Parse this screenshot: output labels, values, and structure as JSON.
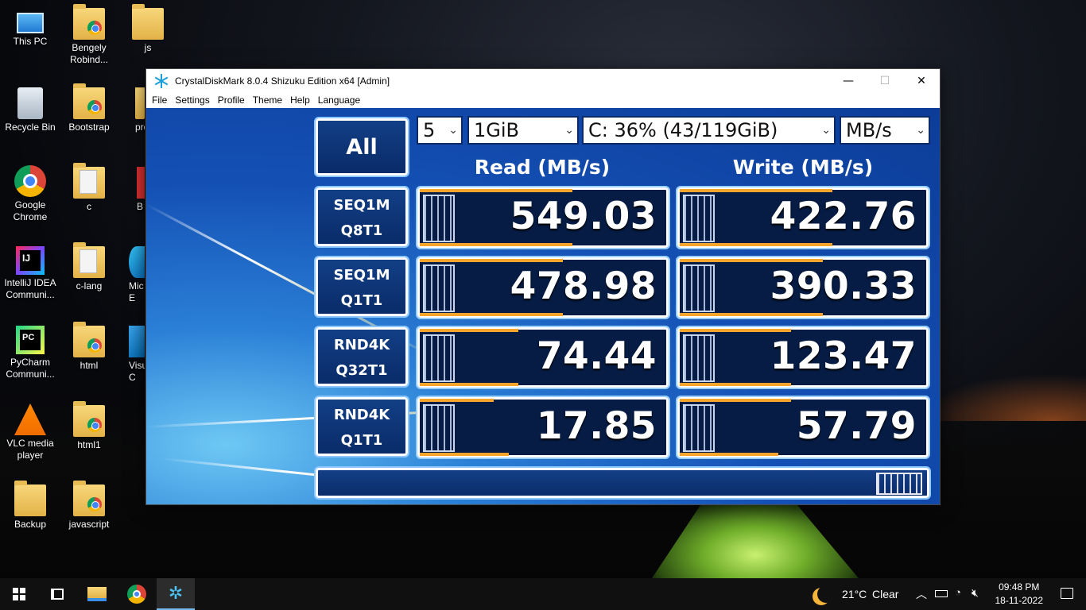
{
  "desktop": {
    "icons": [
      {
        "label": "This PC"
      },
      {
        "label": "Bengely Robind..."
      },
      {
        "label": "js"
      },
      {
        "label": "Recycle Bin"
      },
      {
        "label": "Bootstrap"
      },
      {
        "label": "pro"
      },
      {
        "label": "Google Chrome"
      },
      {
        "label": "c"
      },
      {
        "label": "B"
      },
      {
        "label": "IntelliJ IDEA Communi..."
      },
      {
        "label": "c-lang"
      },
      {
        "label": "Mic E"
      },
      {
        "label": "PyCharm Communi..."
      },
      {
        "label": "html"
      },
      {
        "label": "Visua C"
      },
      {
        "label": "VLC media player"
      },
      {
        "label": "html1"
      },
      {
        "label": "Backup"
      },
      {
        "label": "javascript"
      }
    ]
  },
  "window": {
    "title": "CrystalDiskMark 8.0.4 Shizuku Edition x64 [Admin]",
    "controls": {
      "minimize": "—",
      "maximize": "☐",
      "close": "✕"
    },
    "menu": [
      "File",
      "Settings",
      "Profile",
      "Theme",
      "Help",
      "Language"
    ]
  },
  "cdm": {
    "all_label": "All",
    "count": "5",
    "size": "1GiB",
    "drive": "C: 36% (43/119GiB)",
    "unit": "MB/s",
    "read_header": "Read (MB/s)",
    "write_header": "Write (MB/s)",
    "tests": [
      {
        "line1": "SEQ1M",
        "line2": "Q8T1",
        "read": "549.03",
        "write": "422.76"
      },
      {
        "line1": "SEQ1M",
        "line2": "Q1T1",
        "read": "478.98",
        "write": "390.33"
      },
      {
        "line1": "RND4K",
        "line2": "Q32T1",
        "read": "74.44",
        "write": "123.47"
      },
      {
        "line1": "RND4K",
        "line2": "Q1T1",
        "read": "17.85",
        "write": "57.79"
      }
    ],
    "status_text": ""
  },
  "taskbar": {
    "weather_temp": "21°C",
    "weather_text": "Clear",
    "time": "09:48 PM",
    "date": "18-11-2022"
  }
}
